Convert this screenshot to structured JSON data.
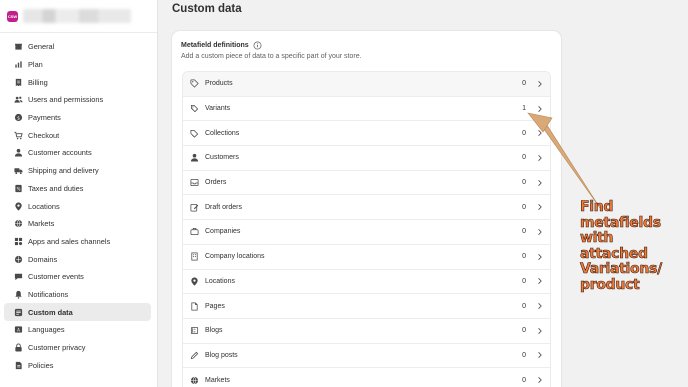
{
  "store": {
    "logo_text": "CSW",
    "name": ""
  },
  "sidebar": {
    "items": [
      {
        "label": "General",
        "icon": "store-icon"
      },
      {
        "label": "Plan",
        "icon": "chart-icon"
      },
      {
        "label": "Billing",
        "icon": "receipt-icon"
      },
      {
        "label": "Users and permissions",
        "icon": "users-icon"
      },
      {
        "label": "Payments",
        "icon": "payment-icon"
      },
      {
        "label": "Checkout",
        "icon": "cart-icon"
      },
      {
        "label": "Customer accounts",
        "icon": "person-icon"
      },
      {
        "label": "Shipping and delivery",
        "icon": "truck-icon"
      },
      {
        "label": "Taxes and duties",
        "icon": "tax-icon"
      },
      {
        "label": "Locations",
        "icon": "location-icon"
      },
      {
        "label": "Markets",
        "icon": "globe-icon"
      },
      {
        "label": "Apps and sales channels",
        "icon": "apps-icon"
      },
      {
        "label": "Domains",
        "icon": "domain-icon"
      },
      {
        "label": "Customer events",
        "icon": "events-icon"
      },
      {
        "label": "Notifications",
        "icon": "bell-icon"
      },
      {
        "label": "Custom data",
        "icon": "data-icon"
      },
      {
        "label": "Languages",
        "icon": "language-icon"
      },
      {
        "label": "Customer privacy",
        "icon": "lock-icon"
      },
      {
        "label": "Policies",
        "icon": "policy-icon"
      }
    ],
    "active": "Custom data"
  },
  "page": {
    "title": "Custom data"
  },
  "card": {
    "title": "Metafield definitions",
    "subtitle": "Add a custom piece of data to a specific part of your store.",
    "rows": [
      {
        "label": "Products",
        "count": "0",
        "icon": "tag-icon"
      },
      {
        "label": "Variants",
        "count": "1",
        "icon": "variant-tag-icon"
      },
      {
        "label": "Collections",
        "count": "0",
        "icon": "collection-icon"
      },
      {
        "label": "Customers",
        "count": "0",
        "icon": "person-icon"
      },
      {
        "label": "Orders",
        "count": "0",
        "icon": "inbox-icon"
      },
      {
        "label": "Draft orders",
        "count": "0",
        "icon": "draft-icon"
      },
      {
        "label": "Companies",
        "count": "0",
        "icon": "briefcase-icon"
      },
      {
        "label": "Company locations",
        "count": "0",
        "icon": "building-icon"
      },
      {
        "label": "Locations",
        "count": "0",
        "icon": "location-icon"
      },
      {
        "label": "Pages",
        "count": "0",
        "icon": "page-icon"
      },
      {
        "label": "Blogs",
        "count": "0",
        "icon": "blog-icon"
      },
      {
        "label": "Blog posts",
        "count": "0",
        "icon": "pen-icon"
      },
      {
        "label": "Markets",
        "count": "0",
        "icon": "globe-icon"
      }
    ]
  },
  "annotation": {
    "lines": [
      "Find",
      "metafields",
      "with",
      "attached",
      "Variations/",
      "product"
    ],
    "color": "#ef7b3c",
    "arrow_color": "#d9a978"
  }
}
